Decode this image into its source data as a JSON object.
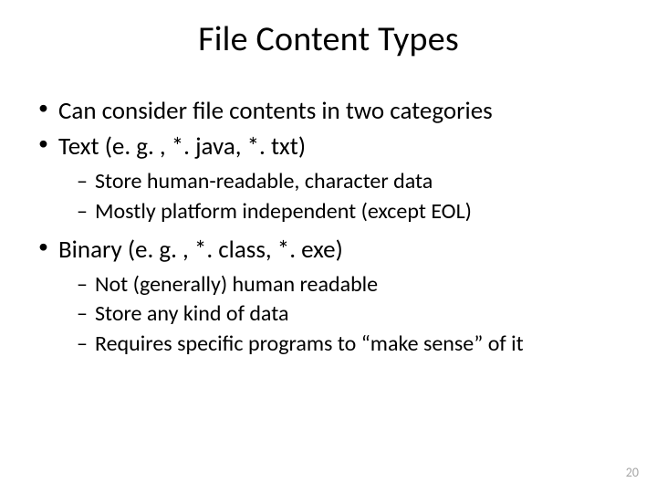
{
  "slide": {
    "title": "File Content Types",
    "bullets": [
      {
        "text": "Can consider file contents in two categories",
        "sub": []
      },
      {
        "text": "Text (e. g. , *. java, *. txt)",
        "sub": [
          "Store human-readable, character data",
          "Mostly platform independent (except EOL)"
        ]
      },
      {
        "text": "Binary (e. g. , *. class, *. exe)",
        "sub": [
          "Not (generally) human readable",
          "Store any kind of data",
          "Requires specific programs to “make sense” of it"
        ]
      }
    ],
    "page_number": "20"
  }
}
